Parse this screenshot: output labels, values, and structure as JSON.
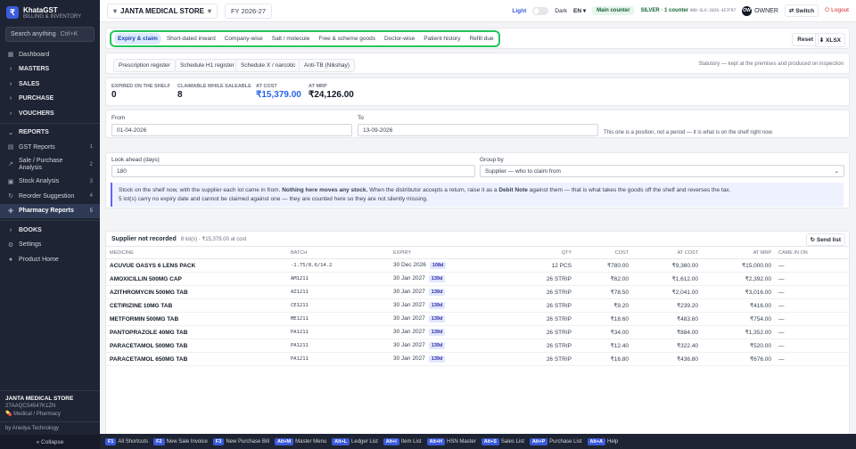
{
  "brand": {
    "logo": "₹",
    "name": "KhataGST",
    "subtitle": "BILLING & INVENTORY"
  },
  "search": {
    "placeholder": "Search anything",
    "shortcut": "Ctrl+K"
  },
  "nav": [
    {
      "label": "Dashboard",
      "icon": "grid-icon",
      "type": "item"
    },
    {
      "label": "MASTERS",
      "type": "section"
    },
    {
      "label": "SALES",
      "type": "section"
    },
    {
      "label": "PURCHASE",
      "type": "section"
    },
    {
      "label": "VOUCHERS",
      "type": "section"
    },
    {
      "label": "REPORTS",
      "type": "section-open"
    },
    {
      "label": "GST Reports",
      "count": "1"
    },
    {
      "label": "Sale / Purchase Analysis",
      "count": "2"
    },
    {
      "label": "Stock Analysis",
      "count": "3"
    },
    {
      "label": "Reorder Suggestion",
      "count": "4"
    },
    {
      "label": "Pharmacy Reports",
      "count": "5",
      "active": true
    },
    {
      "label": "BOOKS",
      "type": "section"
    },
    {
      "label": "Settings",
      "icon": "gear-icon"
    },
    {
      "label": "Product Home",
      "icon": "person-icon"
    }
  ],
  "store_footer": {
    "name": "JANTA MEDICAL STORE",
    "gstin": "27AAQCS4547K1ZN",
    "type": "Medical / Pharmacy",
    "by": "by Anedya Technology",
    "collapse": "« Collapse"
  },
  "topbar": {
    "store": "JANTA MEDICAL STORE",
    "fy": "FY 2026-27",
    "light": "Light",
    "dark": "Dark",
    "lang": "EN",
    "main_counter": "Main counter",
    "plan": "SILVER · 1 counter",
    "plan_code": "ANO-SLV-2026-4E7F97",
    "owner_initials": "OW",
    "owner": "OWNER",
    "switch": "Switch",
    "logout": "Logout"
  },
  "tabs": [
    "Expiry & claim",
    "Short-dated inward",
    "Company-wise",
    "Salt / molecule",
    "Free & scheme goods",
    "Doctor-wise",
    "Patient history",
    "Refill due"
  ],
  "actions": {
    "reset": "Reset",
    "xls": "XLSX"
  },
  "registers": [
    "Prescription register",
    "Schedule H1 register",
    "Schedule X / narcotic",
    "Anti-TB (Nikshay)"
  ],
  "registers_note": "Statutory — kept at the premises and produced on inspection",
  "stats": [
    {
      "label": "EXPIRED ON THE SHELF",
      "value": "0"
    },
    {
      "label": "CLAIMABLE WHILE SALEABLE",
      "value": "8"
    },
    {
      "label": "AT COST",
      "value": "₹15,379.00"
    },
    {
      "label": "AT MRP",
      "value": "₹24,126.00"
    }
  ],
  "filters": {
    "from_label": "From",
    "from": "01-04-2026",
    "to_label": "To",
    "to": "13-09-2026",
    "note": "This one is a position, not a period — it is what is on the shelf right now."
  },
  "options": {
    "lookahead_label": "Look ahead (days)",
    "lookahead": "180",
    "group_label": "Group by",
    "group": "Supplier — who to claim from",
    "info_1a": "Stock on the shelf now, with the supplier each lot came in from.",
    "info_1b": "Nothing here moves any stock.",
    "info_1c": "When the distributor accepts a return, raise it as a",
    "info_1d": "Debit Note",
    "info_1e": "against them — that is what takes the goods off the shelf and reverses the tax.",
    "info_2": "5 lot(s) carry no expiry date and cannot be claimed against one — they are counted here so they are not silently missing."
  },
  "table": {
    "title": "Supplier not recorded",
    "sub": "8 lot(s) · ₹15,379.00 at cost",
    "send": "Send list",
    "columns": [
      "MEDICINE",
      "BATCH",
      "EXPIRY",
      "QTY",
      "COST",
      "AT COST",
      "AT MRP",
      "CAME IN ON"
    ],
    "rows": [
      {
        "med": "ACUVUE OASYS 6 LENS PACK",
        "batch": "-1.75/8.6/14.2",
        "expiry": "30 Dec 2026",
        "days": "108d",
        "qty": "12 PCS",
        "cost": "₹780.00",
        "at_cost": "₹9,360.00",
        "at_mrp": "₹15,000.00",
        "came": "—"
      },
      {
        "med": "AMOXICILLIN 500MG CAP",
        "batch": "AM1211",
        "expiry": "30 Jan 2027",
        "days": "139d",
        "qty": "26 STRIP",
        "cost": "₹62.00",
        "at_cost": "₹1,612.00",
        "at_mrp": "₹2,392.00",
        "came": "—"
      },
      {
        "med": "AZITHROMYCIN 500MG TAB",
        "batch": "AZ1211",
        "expiry": "30 Jan 2027",
        "days": "139d",
        "qty": "26 STRIP",
        "cost": "₹78.50",
        "at_cost": "₹2,041.00",
        "at_mrp": "₹3,016.00",
        "came": "—"
      },
      {
        "med": "CETIRIZINE 10MG TAB",
        "batch": "CE1211",
        "expiry": "30 Jan 2027",
        "days": "139d",
        "qty": "26 STRIP",
        "cost": "₹9.20",
        "at_cost": "₹239.20",
        "at_mrp": "₹416.00",
        "came": "—"
      },
      {
        "med": "METFORMIN 500MG TAB",
        "batch": "ME1211",
        "expiry": "30 Jan 2027",
        "days": "139d",
        "qty": "26 STRIP",
        "cost": "₹18.60",
        "at_cost": "₹483.60",
        "at_mrp": "₹754.00",
        "came": "—"
      },
      {
        "med": "PANTOPRAZOLE 40MG TAB",
        "batch": "PA1211",
        "expiry": "30 Jan 2027",
        "days": "139d",
        "qty": "26 STRIP",
        "cost": "₹34.00",
        "at_cost": "₹884.00",
        "at_mrp": "₹1,352.00",
        "came": "—"
      },
      {
        "med": "PARACETAMOL 500MG TAB",
        "batch": "PA1211",
        "expiry": "30 Jan 2027",
        "days": "139d",
        "qty": "26 STRIP",
        "cost": "₹12.40",
        "at_cost": "₹322.40",
        "at_mrp": "₹520.00",
        "came": "—"
      },
      {
        "med": "PARACETAMOL 650MG TAB",
        "batch": "PA1211",
        "expiry": "30 Jan 2027",
        "days": "139d",
        "qty": "26 STRIP",
        "cost": "₹16.80",
        "at_cost": "₹436.80",
        "at_mrp": "₹676.00",
        "came": "—"
      }
    ]
  },
  "shortcuts": [
    {
      "key": "F1",
      "label": "All Shortcuts"
    },
    {
      "key": "F2",
      "label": "New Sale Invoice"
    },
    {
      "key": "F3",
      "label": "New Purchase Bill"
    },
    {
      "key": "Alt+M",
      "label": "Master Menu"
    },
    {
      "key": "Alt+L",
      "label": "Ledger List"
    },
    {
      "key": "Alt+I",
      "label": "Item List"
    },
    {
      "key": "Alt+H",
      "label": "HSN Master"
    },
    {
      "key": "Alt+S",
      "label": "Sales List"
    },
    {
      "key": "Alt+P",
      "label": "Purchase List"
    },
    {
      "key": "Alt+A",
      "label": "Help"
    }
  ]
}
